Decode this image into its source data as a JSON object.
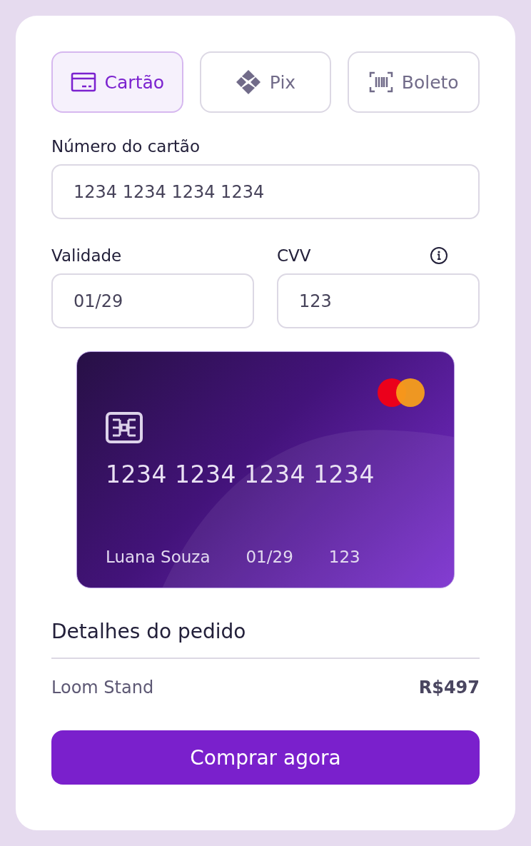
{
  "payment_methods": [
    {
      "kind": "card",
      "label": "Cartão",
      "selected": true
    },
    {
      "kind": "pix",
      "label": "Pix",
      "selected": false
    },
    {
      "kind": "boleto",
      "label": "Boleto",
      "selected": false
    }
  ],
  "card_number_field": {
    "label": "Número do cartão",
    "value": "1234 1234 1234 1234"
  },
  "expiry_field": {
    "label": "Validade",
    "value": "01/29"
  },
  "cvv_field": {
    "label": "CVV",
    "value": "123"
  },
  "card_preview": {
    "number": "1234 1234 1234 1234",
    "holder": "Luana Souza",
    "expiry": "01/29",
    "cvv": "123"
  },
  "order_details": {
    "title": "Detalhes do pedido",
    "items": [
      {
        "name": "Loom Stand",
        "price": "R$497"
      }
    ]
  },
  "buy_button": "Comprar agora"
}
